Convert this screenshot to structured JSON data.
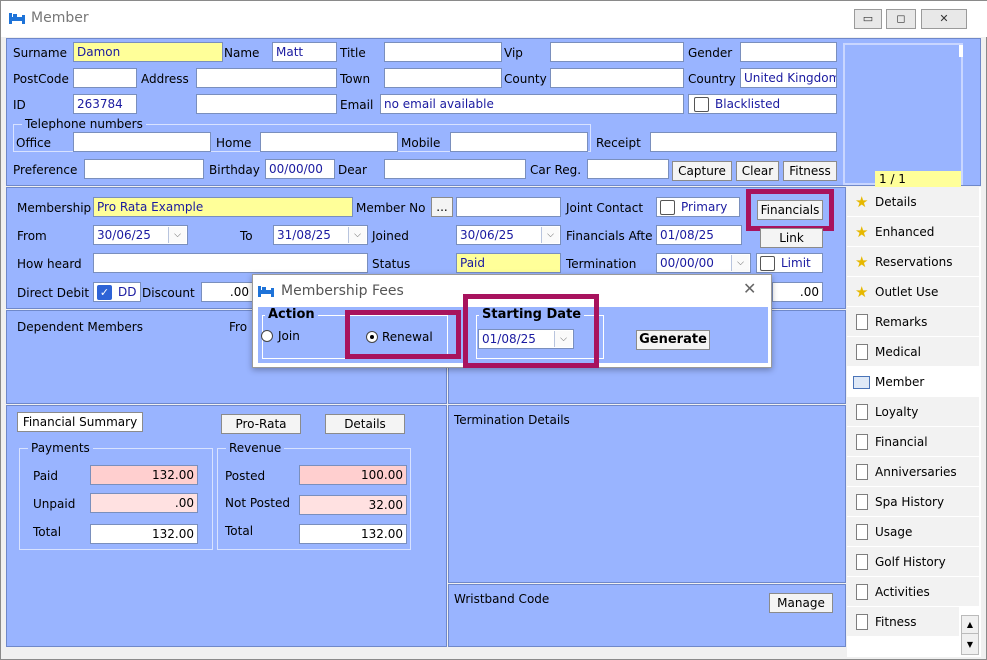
{
  "window": {
    "title": "Member"
  },
  "member": {
    "surname_label": "Surname",
    "surname": "Damon",
    "name_label": "Name",
    "name": "Matt",
    "title_label": "Title",
    "title": "",
    "vip_label": "Vip",
    "vip": "",
    "gender_label": "Gender",
    "gender": "",
    "postcode_label": "PostCode",
    "postcode": "",
    "address_label": "Address",
    "address1": "",
    "address2": "",
    "town_label": "Town",
    "town": "",
    "county_label": "County",
    "county": "",
    "country_label": "Country",
    "country": "United Kingdom",
    "id_label": "ID",
    "id": "263784",
    "email_label": "Email",
    "email": "no email available",
    "blacklisted_label": "Blacklisted",
    "telephone_group": "Telephone numbers",
    "office_label": "Office",
    "home_label": "Home",
    "mobile_label": "Mobile",
    "receipt_label": "Receipt",
    "preference_label": "Preference",
    "preference": "",
    "birthday_label": "Birthday",
    "birthday": "00/00/00",
    "dear_label": "Dear",
    "dear": "",
    "carreg_label": "Car Reg.",
    "carreg": "",
    "capture_label": "Capture",
    "clear_label": "Clear",
    "fitness_label": "Fitness",
    "photo_counter": "1 / 1"
  },
  "membership": {
    "membership_label": "Membership",
    "membership": "Pro Rata Example",
    "memberno_label": "Member No",
    "memberno_btn": "...",
    "memberno": "",
    "joint_label": "Joint Contact",
    "primary_label": "Primary",
    "financials_label": "Financials",
    "link_label": "Link",
    "from_label": "From",
    "from": "30/06/25",
    "to_label": "To",
    "to": "31/08/25",
    "joined_label": "Joined",
    "joined": "30/06/25",
    "financials_after_label": "Financials Afte",
    "financials_after": "01/08/25",
    "howheard_label": "How heard",
    "howheard": "",
    "status_label": "Status",
    "status": "Paid",
    "termination_label": "Termination",
    "termination": "00/00/00",
    "limit_label": "Limit",
    "directdebit_label": "Direct Debit",
    "dd_label": "DD",
    "discount_label": "Discount",
    "discount": ".00",
    "right_value": ".00"
  },
  "dependents": {
    "label": "Dependent Members",
    "from_label": "Fro"
  },
  "financial_summary": {
    "tab_label": "Financial Summary",
    "prorata_label": "Pro-Rata",
    "details_label": "Details",
    "payments_group": "Payments",
    "revenue_group": "Revenue",
    "paid_label": "Paid",
    "paid": "132.00",
    "unpaid_label": "Unpaid",
    "unpaid": ".00",
    "total_label": "Total",
    "total": "132.00",
    "posted_label": "Posted",
    "posted": "100.00",
    "notposted_label": "Not Posted",
    "notposted": "32.00",
    "rev_total_label": "Total",
    "rev_total": "132.00"
  },
  "termination_details": {
    "label": "Termination Details"
  },
  "wristband": {
    "label": "Wristband Code",
    "manage_label": "Manage"
  },
  "sidebar": {
    "items": [
      {
        "label": "Details",
        "icon": "star-icon"
      },
      {
        "label": "Enhanced",
        "icon": "star-icon"
      },
      {
        "label": "Reservations",
        "icon": "star-icon"
      },
      {
        "label": "Outlet Use",
        "icon": "star-icon"
      },
      {
        "label": "Remarks",
        "icon": "page-icon"
      },
      {
        "label": "Medical",
        "icon": "page-icon"
      },
      {
        "label": "Member",
        "icon": "member-card-icon"
      },
      {
        "label": "Loyalty",
        "icon": "page-icon"
      },
      {
        "label": "Financial",
        "icon": "page-icon"
      },
      {
        "label": "Anniversaries",
        "icon": "page-icon"
      },
      {
        "label": "Spa History",
        "icon": "page-icon"
      },
      {
        "label": "Usage",
        "icon": "page-icon"
      },
      {
        "label": "Golf History",
        "icon": "page-icon"
      },
      {
        "label": "Activities",
        "icon": "page-icon"
      },
      {
        "label": "Fitness",
        "icon": "page-icon"
      }
    ]
  },
  "dialog": {
    "title": "Membership Fees",
    "action_label": "Action",
    "join_label": "Join",
    "renewal_label": "Renewal",
    "starting_date_label": "Starting Date",
    "starting_date": "01/08/25",
    "generate_label": "Generate"
  },
  "colors": {
    "panel": "#99b4ff",
    "yellow_field": "#ffff99",
    "pink_field": "#ffcfcf",
    "highlight": "#a8135e"
  }
}
